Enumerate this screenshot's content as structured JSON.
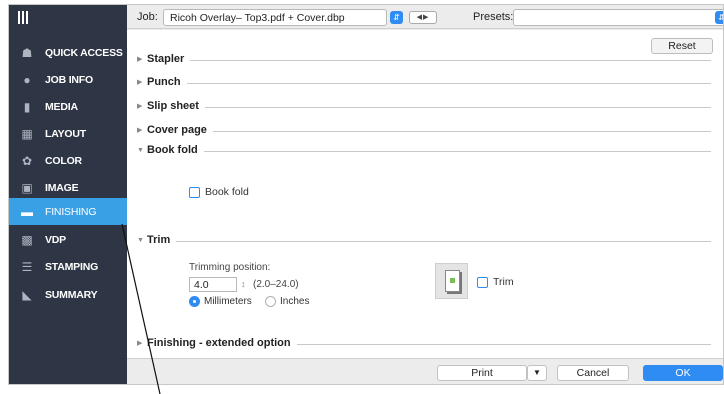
{
  "toolbar": {
    "job_label": "Job:",
    "job_value": "Ricoh Overlay– Top3.pdf + Cover.dbp",
    "presets_label": "Presets:",
    "presets_value": ""
  },
  "sidebar": {
    "items": [
      {
        "label": "QUICK ACCESS",
        "icon": "house-icon",
        "active": false
      },
      {
        "label": "JOB INFO",
        "icon": "info-icon",
        "active": false
      },
      {
        "label": "MEDIA",
        "icon": "page-icon",
        "active": false
      },
      {
        "label": "LAYOUT",
        "icon": "layout-icon",
        "active": false
      },
      {
        "label": "COLOR",
        "icon": "color-icon",
        "active": false
      },
      {
        "label": "IMAGE",
        "icon": "image-icon",
        "active": false
      },
      {
        "label": "FINISHING",
        "icon": "finishing-icon",
        "active": true
      },
      {
        "label": "VDP",
        "icon": "vdp-icon",
        "active": false
      },
      {
        "label": "STAMPING",
        "icon": "stamping-icon",
        "active": false
      },
      {
        "label": "SUMMARY",
        "icon": "summary-icon",
        "active": false
      }
    ]
  },
  "content": {
    "reset_label": "Reset",
    "sections": {
      "stapler": "Stapler",
      "punch": "Punch",
      "slip_sheet": "Slip sheet",
      "cover_page": "Cover page",
      "book_fold": "Book fold",
      "trim": "Trim",
      "finishing_ext": "Finishing - extended option"
    },
    "book_fold_option": "Book fold",
    "trim": {
      "position_label": "Trimming position:",
      "value": "4.0",
      "range": "(2.0–24.0)",
      "unit_mm": "Millimeters",
      "unit_in": "Inches",
      "selected_unit": "Millimeters",
      "option_label": "Trim"
    }
  },
  "footer": {
    "print_label": "Print",
    "cancel_label": "Cancel",
    "ok_label": "OK"
  },
  "colors": {
    "sidebar_bg": "#2e3544",
    "accent": "#2f8cf2",
    "active_item": "#3aa0e6"
  }
}
